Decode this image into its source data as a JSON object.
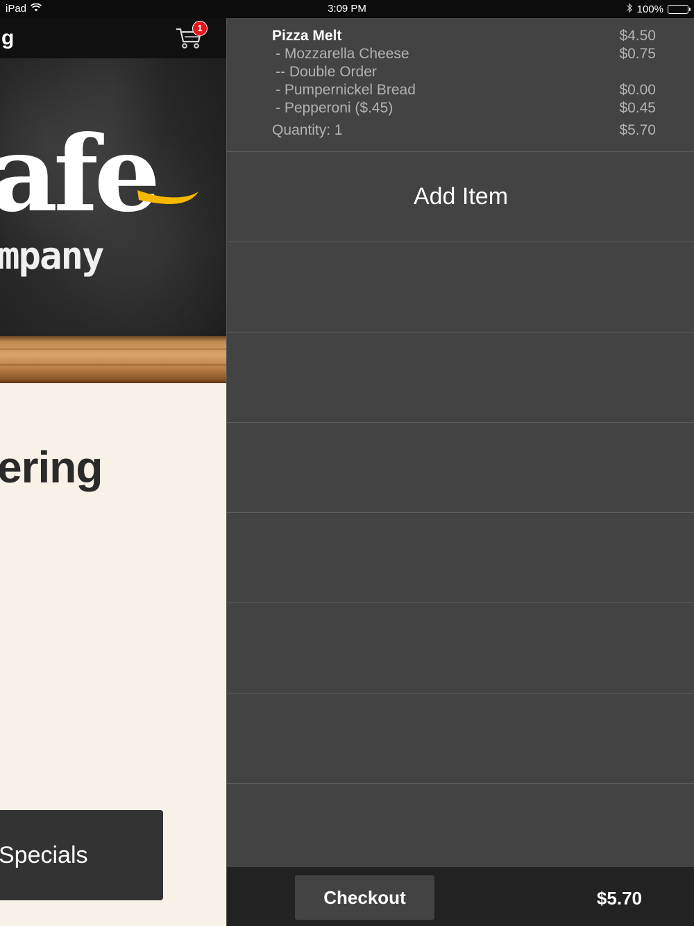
{
  "status_bar": {
    "device": "iPad",
    "time": "3:09 PM",
    "battery": "100%"
  },
  "left_app": {
    "nav_title": "g",
    "cart_badge_count": "1",
    "logo_text": "afe",
    "logo_subtext": "mpany",
    "heading": "ering",
    "specials_label": "Specials"
  },
  "cart": {
    "item": {
      "name": "Pizza Melt",
      "price": "$4.50",
      "modifiers": [
        {
          "label": "- Mozzarella Cheese",
          "price": "$0.75"
        },
        {
          "label": "-- Double Order",
          "price": ""
        },
        {
          "label": "- Pumpernickel Bread",
          "price": "$0.00"
        },
        {
          "label": "- Pepperoni ($.45)",
          "price": "$0.45"
        }
      ],
      "quantity_label": "Quantity: 1",
      "line_total": "$5.70"
    },
    "add_item_label": "Add Item",
    "checkout_label": "Checkout",
    "total": "$5.70"
  },
  "colors": {
    "panel_bg": "#434343",
    "footer_bg": "#222222",
    "badge_red": "#e3141b",
    "accent_yellow": "#f5b800",
    "page_bg": "#f8f1e7"
  }
}
